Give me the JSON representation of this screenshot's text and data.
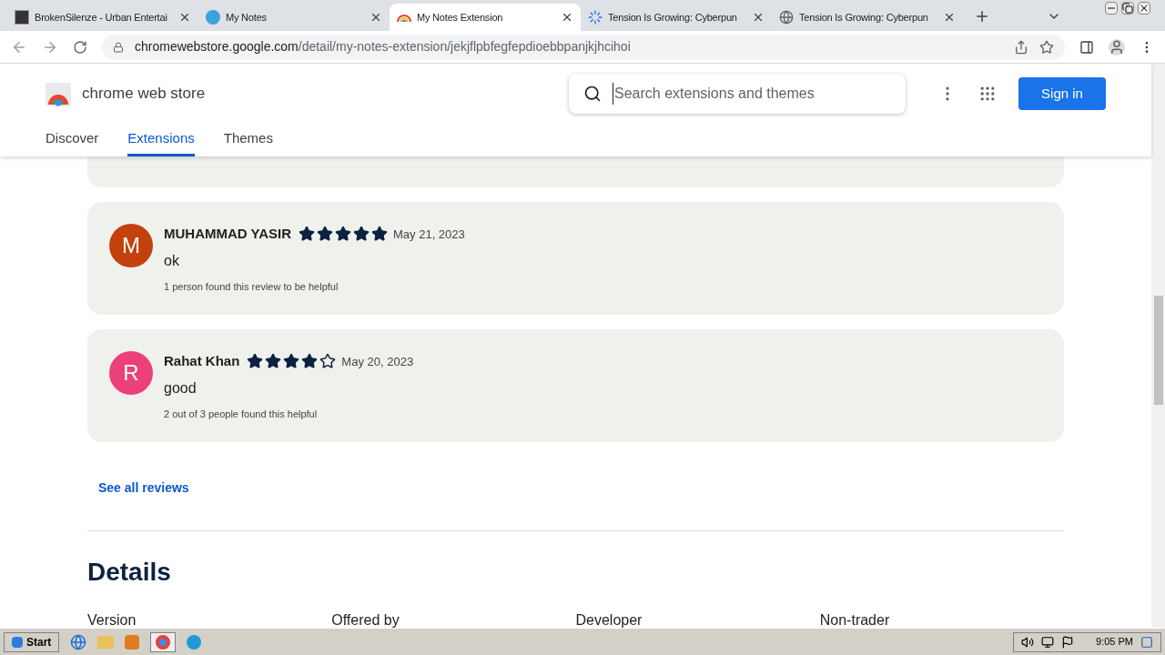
{
  "browser": {
    "tabs": [
      {
        "title": "BrokenSilenze - Urban Entertai",
        "selected": false
      },
      {
        "title": "My Notes",
        "selected": false
      },
      {
        "title": "My Notes Extension",
        "selected": true
      },
      {
        "title": "Tension Is Growing: Cyberpun",
        "selected": false
      },
      {
        "title": "Tension Is Growing: Cyberpun",
        "selected": false
      }
    ],
    "url_host": "chromewebstore.google.com",
    "url_path": "/detail/my-notes-extension/jekjflpbfegfepdioebbpanjkjhcihoi"
  },
  "store": {
    "name": "chrome web store",
    "search": {
      "placeholder": "Search extensions and themes"
    },
    "sign_in": "Sign in",
    "nav": [
      {
        "label": "Discover",
        "selected": false
      },
      {
        "label": "Extensions",
        "selected": true
      },
      {
        "label": "Themes",
        "selected": false
      }
    ]
  },
  "reviews": [
    {
      "initial": "M",
      "color": "#c2410c",
      "name": "MUHAMMAD YASIR",
      "stars": 5,
      "date": "May 21, 2023",
      "text": "ok",
      "helpful": "1 person found this review to be helpful"
    },
    {
      "initial": "R",
      "color": "#ec407a",
      "name": "Rahat Khan",
      "stars": 4,
      "date": "May 20, 2023",
      "text": "good",
      "helpful": "2 out of 3 people found this helpful"
    }
  ],
  "see_all": "See all reviews",
  "details": {
    "title": "Details",
    "columns": [
      "Version",
      "Offered by",
      "Developer",
      "Non-trader"
    ]
  },
  "taskbar": {
    "start": "Start",
    "clock": "9:05 PM"
  }
}
